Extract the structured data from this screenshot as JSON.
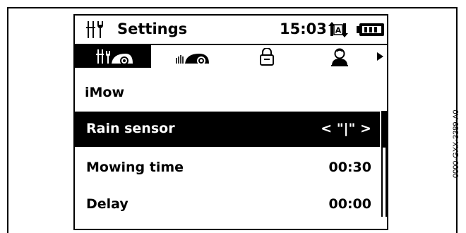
{
  "header": {
    "title": "Settings",
    "time": "15:03",
    "auto_icon_letter": "A",
    "settings_icon": "tools-icon",
    "battery_icon": "battery-icon"
  },
  "tabs": [
    {
      "icon": "mower-settings-icon",
      "active": true
    },
    {
      "icon": "mower-icon",
      "active": false
    },
    {
      "icon": "lock-icon",
      "active": false
    },
    {
      "icon": "user-icon",
      "active": false
    }
  ],
  "section_title": "iMow",
  "rows": [
    {
      "label": "Rain sensor",
      "value": "< \"|\" >",
      "selected": true
    },
    {
      "label": "Mowing time",
      "value": "00:30",
      "selected": false
    },
    {
      "label": "Delay",
      "value": "00:00",
      "selected": false
    }
  ],
  "figure_code": "0000-GXX-3389-A0"
}
